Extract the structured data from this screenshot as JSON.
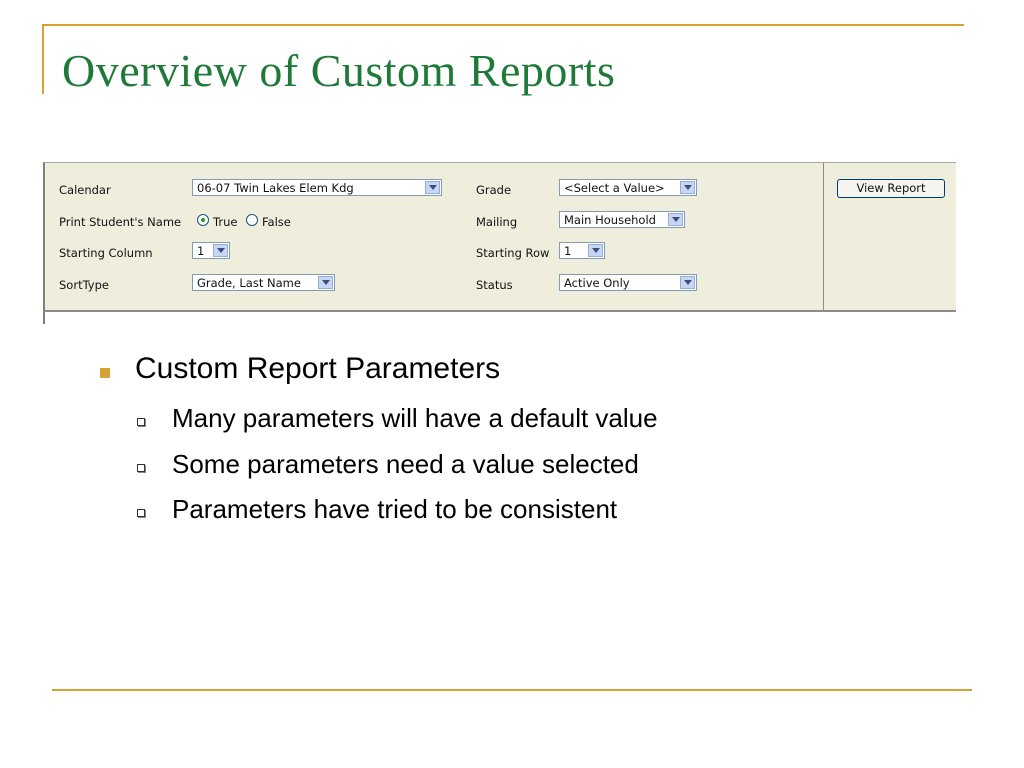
{
  "title": "Overview of Custom Reports",
  "form": {
    "calendar": {
      "label": "Calendar",
      "value": "06-07 Twin Lakes Elem Kdg"
    },
    "print_name": {
      "label": "Print Student's Name",
      "true_label": "True",
      "false_label": "False",
      "selected": "True"
    },
    "starting_column": {
      "label": "Starting Column",
      "value": "1"
    },
    "sort_type": {
      "label": "SortType",
      "value": "Grade, Last Name"
    },
    "grade": {
      "label": "Grade",
      "value": "<Select a Value>"
    },
    "mailing": {
      "label": "Mailing",
      "value": "Main Household"
    },
    "starting_row": {
      "label": "Starting Row",
      "value": "1"
    },
    "status": {
      "label": "Status",
      "value": "Active Only"
    },
    "view_report_label": "View Report"
  },
  "bullets": {
    "main": "Custom Report Parameters",
    "sub": [
      "Many parameters will have a default value",
      "Some parameters need a value selected",
      "Parameters have tried to be consistent"
    ]
  },
  "colors": {
    "accent": "#d6a233",
    "title": "#1f7a3a",
    "panel_bg": "#efeedd"
  },
  "icons": {
    "dropdown": "chevron-down-icon",
    "bullet": "square-bullet-icon",
    "sub_bullet": "hollow-square-bullet-icon"
  }
}
